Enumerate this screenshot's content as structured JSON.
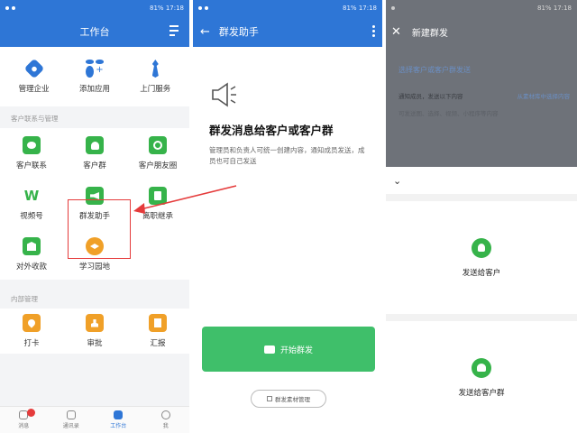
{
  "status": {
    "time_1": "17:18",
    "time_2": "17:18",
    "time_3": "17:18",
    "battery": "81%"
  },
  "screen1": {
    "title": "工作台",
    "top_items": [
      {
        "label": "管理企业",
        "icon": "building-icon"
      },
      {
        "label": "添加应用",
        "icon": "apps-add-icon"
      },
      {
        "label": "上门服务",
        "icon": "tie-icon"
      }
    ],
    "section_customer": "客户联系与管理",
    "customer_items": [
      {
        "label": "客户联系",
        "icon": "chat-icon"
      },
      {
        "label": "客户群",
        "icon": "group-icon"
      },
      {
        "label": "客户朋友圈",
        "icon": "moments-icon"
      },
      {
        "label": "视频号",
        "icon": "video-channel-icon"
      },
      {
        "label": "群发助手",
        "icon": "megaphone-icon"
      },
      {
        "label": "离职继承",
        "icon": "document-icon"
      },
      {
        "label": "对外收款",
        "icon": "payment-icon"
      },
      {
        "label": "学习园地",
        "icon": "graduation-icon"
      }
    ],
    "section_internal": "内部管理",
    "internal_items": [
      {
        "label": "打卡",
        "icon": "location-pin-icon"
      },
      {
        "label": "审批",
        "icon": "stamp-icon"
      },
      {
        "label": "汇报",
        "icon": "report-icon"
      }
    ],
    "tabs": [
      {
        "label": "消息",
        "icon": "message-icon"
      },
      {
        "label": "通讯录",
        "icon": "contacts-icon"
      },
      {
        "label": "工作台",
        "icon": "workbench-icon"
      },
      {
        "label": "我",
        "icon": "profile-icon"
      }
    ]
  },
  "screen2": {
    "title": "群发助手",
    "heading": "群发消息给客户或客户群",
    "description": "管理员和负责人可统一创建内容，通知成员发送，成员也可自己发送",
    "start_button": "开始群发",
    "material_button": "群发素材管理"
  },
  "screen3": {
    "title": "新建群发",
    "select_link": "选择客户或客户群发送",
    "notify_label": "通知成员，发送以下内容",
    "material_link": "从素材库中选择内容",
    "hint": "可发送图、选择、视频、小程序等内容",
    "option1": "发送给客户",
    "option2": "发送给客户群"
  },
  "colors": {
    "brand_blue": "#2e76d6",
    "green": "#36b34a",
    "start_green": "#3fbf6a",
    "highlight_red": "#e53b3b"
  }
}
